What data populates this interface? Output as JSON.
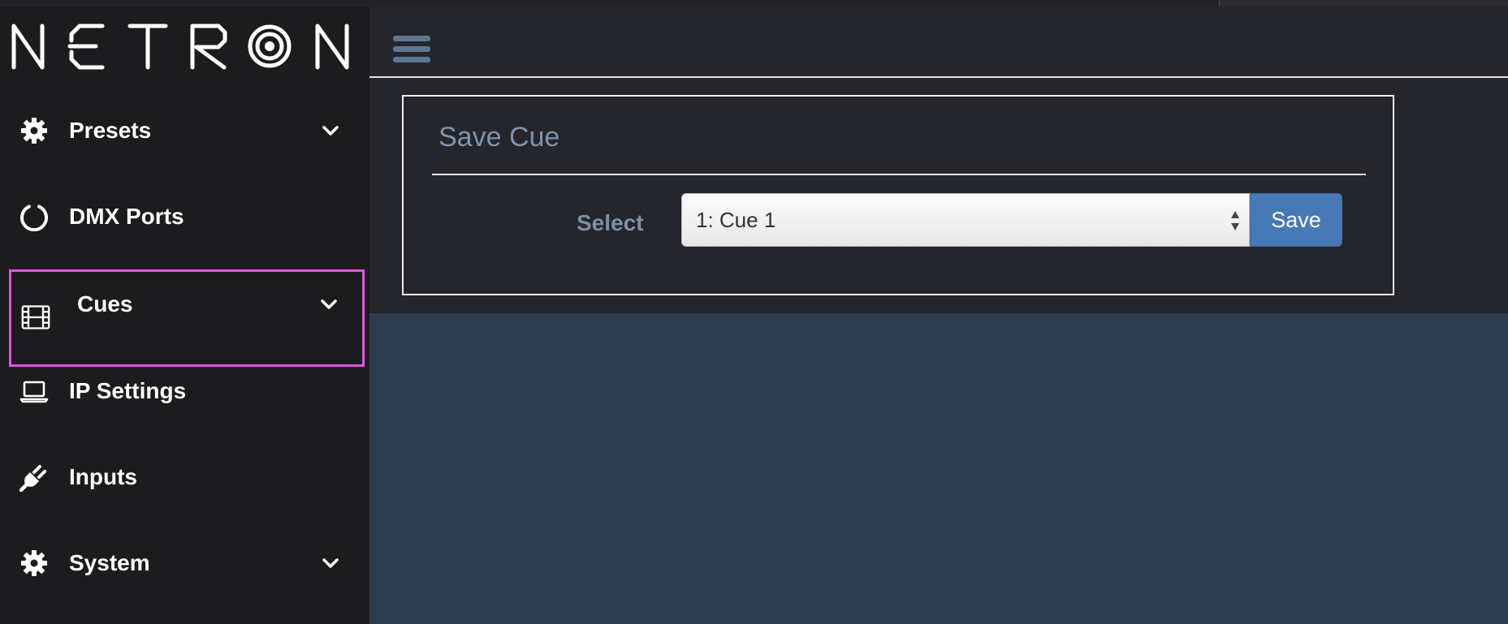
{
  "brand": {
    "logo_text": "NETRON"
  },
  "sidebar": {
    "items": [
      {
        "label": "Presets",
        "icon": "gear-icon",
        "expandable": true
      },
      {
        "label": "DMX Ports",
        "icon": "ring-icon",
        "expandable": false
      },
      {
        "label": "Cues",
        "icon": "film-icon",
        "expandable": true,
        "highlighted": true
      },
      {
        "label": "IP Settings",
        "icon": "laptop-icon",
        "expandable": false
      },
      {
        "label": "Inputs",
        "icon": "plug-icon",
        "expandable": false
      },
      {
        "label": "System",
        "icon": "gear-icon",
        "expandable": true
      }
    ]
  },
  "header": {
    "menu_icon": "hamburger-icon"
  },
  "panel": {
    "title": "Save Cue",
    "select_label": "Select",
    "select_value": "1: Cue 1",
    "save_label": "Save"
  },
  "colors": {
    "sidebar_bg": "#1c1c1f",
    "main_bg": "#2e3c50",
    "panel_bg": "#25262b",
    "accent": "#4679b5",
    "highlight": "#e055e0"
  }
}
